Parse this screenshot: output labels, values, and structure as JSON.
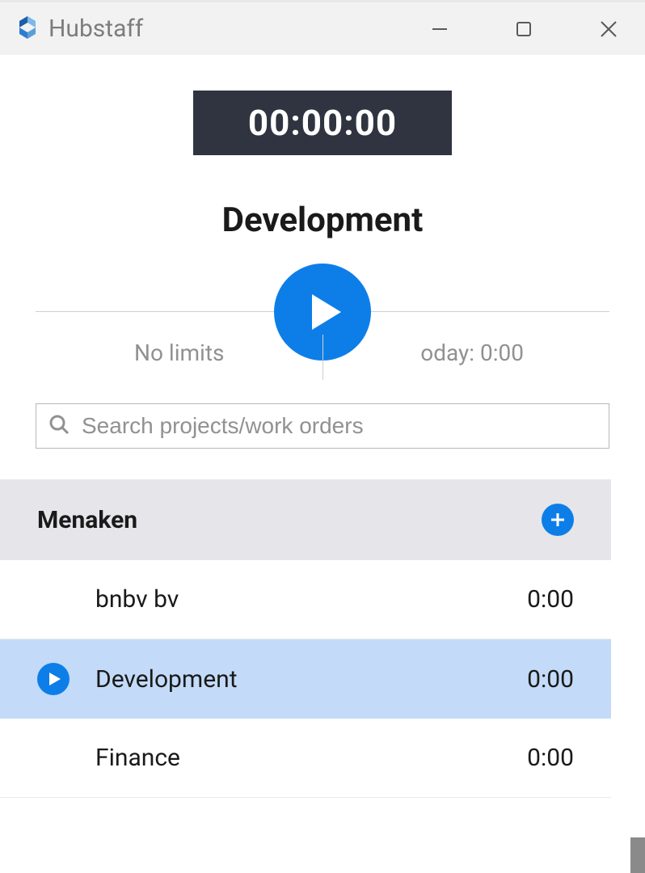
{
  "app": {
    "title": "Hubstaff"
  },
  "timer": {
    "display": "00:00:00"
  },
  "current_project": "Development",
  "info": {
    "limits": "No limits",
    "today": "oday: 0:00"
  },
  "search": {
    "placeholder": "Search projects/work orders"
  },
  "group": {
    "name": "Menaken"
  },
  "projects": [
    {
      "name": "bnbv bv",
      "time": "0:00",
      "selected": false
    },
    {
      "name": "Development",
      "time": "0:00",
      "selected": true
    },
    {
      "name": "Finance",
      "time": "0:00",
      "selected": false
    }
  ]
}
